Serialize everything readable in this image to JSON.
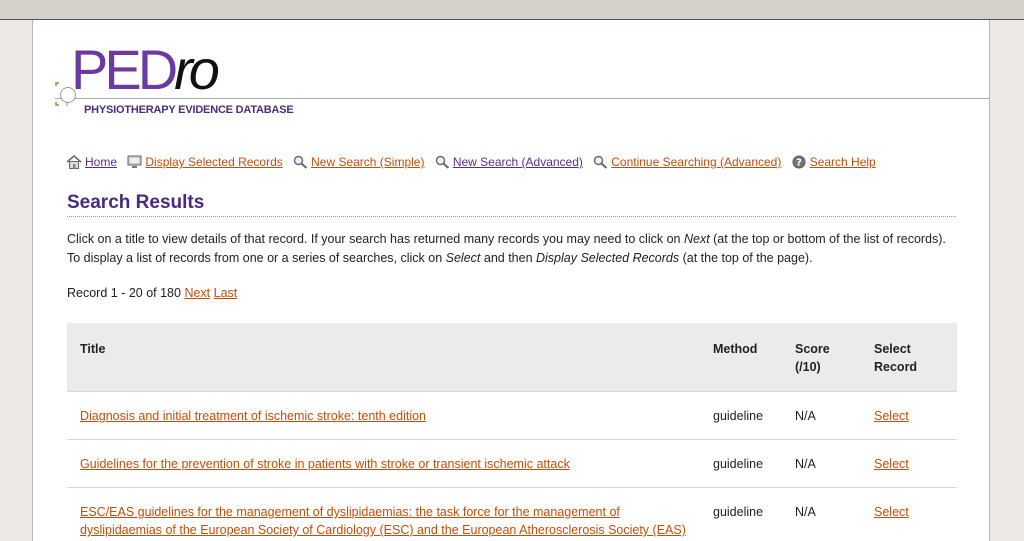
{
  "logo": {
    "main": "PED",
    "suffix": "ro",
    "subtitle": "PHYSIOTHERAPY EVIDENCE DATABASE"
  },
  "nav": [
    {
      "label": "Home",
      "icon": "home-icon"
    },
    {
      "label": "Display Selected Records",
      "icon": "display-records-icon"
    },
    {
      "label": "New Search (Simple)",
      "icon": "magnifier-icon"
    },
    {
      "label": "New Search (Advanced)",
      "icon": "magnifier-icon"
    },
    {
      "label": "Continue Searching (Advanced)",
      "icon": "magnifier-icon"
    },
    {
      "label": "Search Help",
      "icon": "help-icon"
    }
  ],
  "page": {
    "title": "Search Results",
    "intro": {
      "p1": "Click on a title to view details of that record. If your search has returned many records you may need to click on ",
      "em1": "Next",
      "p2": " (at the top or bottom of the list of records). To display a list of records from one or a series of searches, click on ",
      "em2": "Select",
      "p3": " and then ",
      "em3": "Display Selected Records",
      "p4": " (at the top of the page)."
    },
    "record_range": "Record 1 - 20 of 180",
    "next_label": "Next",
    "last_label": "Last"
  },
  "table": {
    "headers": {
      "title": "Title",
      "method": "Method",
      "score_line1": "Score",
      "score_line2": "(/10)",
      "select_line1": "Select",
      "select_line2": "Record"
    },
    "rows": [
      {
        "title": "Diagnosis and initial treatment of ischemic stroke: tenth edition",
        "method": "guideline",
        "score": "N/A",
        "select": "Select"
      },
      {
        "title": "Guidelines for the prevention of stroke in patients with stroke or transient ischemic attack",
        "method": "guideline",
        "score": "N/A",
        "select": "Select"
      },
      {
        "title": "ESC/EAS guidelines for the management of dyslipidaemias: the task force for the management of dyslipidaemias of the European Society of Cardiology (ESC) and the European Atherosclerosis Society (EAS)",
        "method": "guideline",
        "score": "N/A",
        "select": "Select"
      }
    ]
  },
  "colors": {
    "link": "#c24d0c",
    "visited_link": "#5a2d8a",
    "heading": "#4a2a7c",
    "header_bg": "#ebebeb"
  }
}
